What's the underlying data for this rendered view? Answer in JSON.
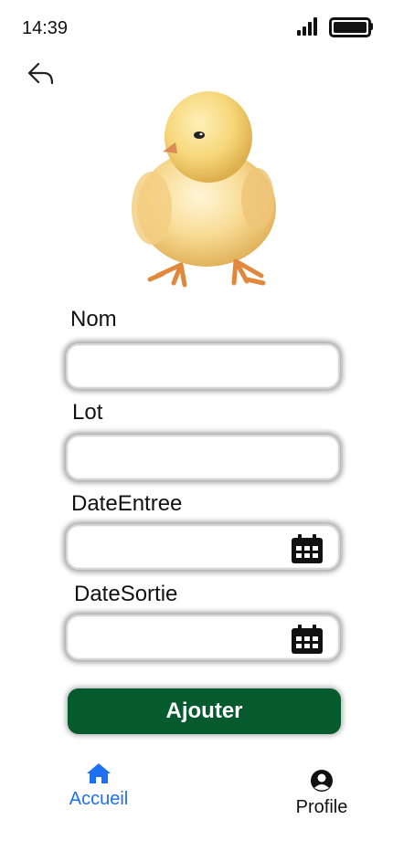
{
  "status_bar": {
    "time": "14:39"
  },
  "form": {
    "fields": [
      {
        "label": "Nom",
        "value": "",
        "placeholder": ""
      },
      {
        "label": "Lot",
        "value": "",
        "placeholder": ""
      },
      {
        "label": "DateEntree",
        "value": "",
        "placeholder": ""
      },
      {
        "label": "DateSortie",
        "value": "",
        "placeholder": ""
      }
    ],
    "submit_label": "Ajouter"
  },
  "bottom_nav": {
    "items": [
      {
        "label": "Accueil",
        "icon": "home-icon",
        "active": true
      },
      {
        "label": "Profile",
        "icon": "user-circle-icon",
        "active": false
      }
    ]
  },
  "colors": {
    "accent": "#1e6ff1",
    "button": "#055a2e",
    "button_text": "#ffffff"
  }
}
